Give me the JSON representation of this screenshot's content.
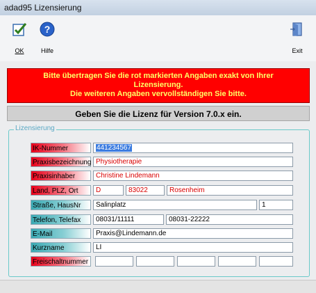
{
  "window": {
    "title": "adad95 Lizensierung"
  },
  "toolbar": {
    "ok_label": "OK",
    "help_label": "Hilfe",
    "exit_label": "Exit",
    "ok_underline": "O",
    "help_underline": "H",
    "exit_underline": "x"
  },
  "banner": {
    "line1": "Bitte übertragen Sie die rot markierten Angaben exakt von Ihrer",
    "line2": "Lizensierung.",
    "line3": "Die weiteren Angaben vervollständigen Sie bitte."
  },
  "version_text": "Geben Sie die Lizenz für Version 7.0.x ein.",
  "group": {
    "legend": "Lizensierung"
  },
  "fields": {
    "ik": {
      "label": "IK-Nummer",
      "value": "441234567"
    },
    "praxisbezeichnung": {
      "label": "Praxisbezeichnung",
      "value": "Physiotherapie"
    },
    "praxisinhaber": {
      "label": "Praxisinhaber",
      "value": "Christine Lindemann"
    },
    "land": {
      "label": "Land, PLZ, Ort",
      "land": "D",
      "plz": "83022",
      "ort": "Rosenheim"
    },
    "strasse": {
      "label": "Straße, HausNr",
      "strasse": "Salinplatz",
      "hausnr": "1"
    },
    "telefon": {
      "label": "Telefon, Telefax",
      "telefon": "08031/11111",
      "telefax": "08031-22222"
    },
    "email": {
      "label": "E-Mail",
      "value": "Praxis@Lindemann.de"
    },
    "kurzname": {
      "label": "Kurzname",
      "value": "LI"
    },
    "freischalt": {
      "label": "Freischaltnummer",
      "parts": [
        "",
        "",
        "",
        "",
        ""
      ]
    }
  },
  "colors": {
    "banner_bg": "#ff0000",
    "banner_text": "#ffff66",
    "required_label": "#e8001a",
    "optional_label": "#3aa9b3",
    "required_value_text": "#d90000"
  },
  "icons": {
    "ok": "checkmark-page-icon",
    "help": "help-question-icon",
    "exit": "exit-door-icon"
  }
}
